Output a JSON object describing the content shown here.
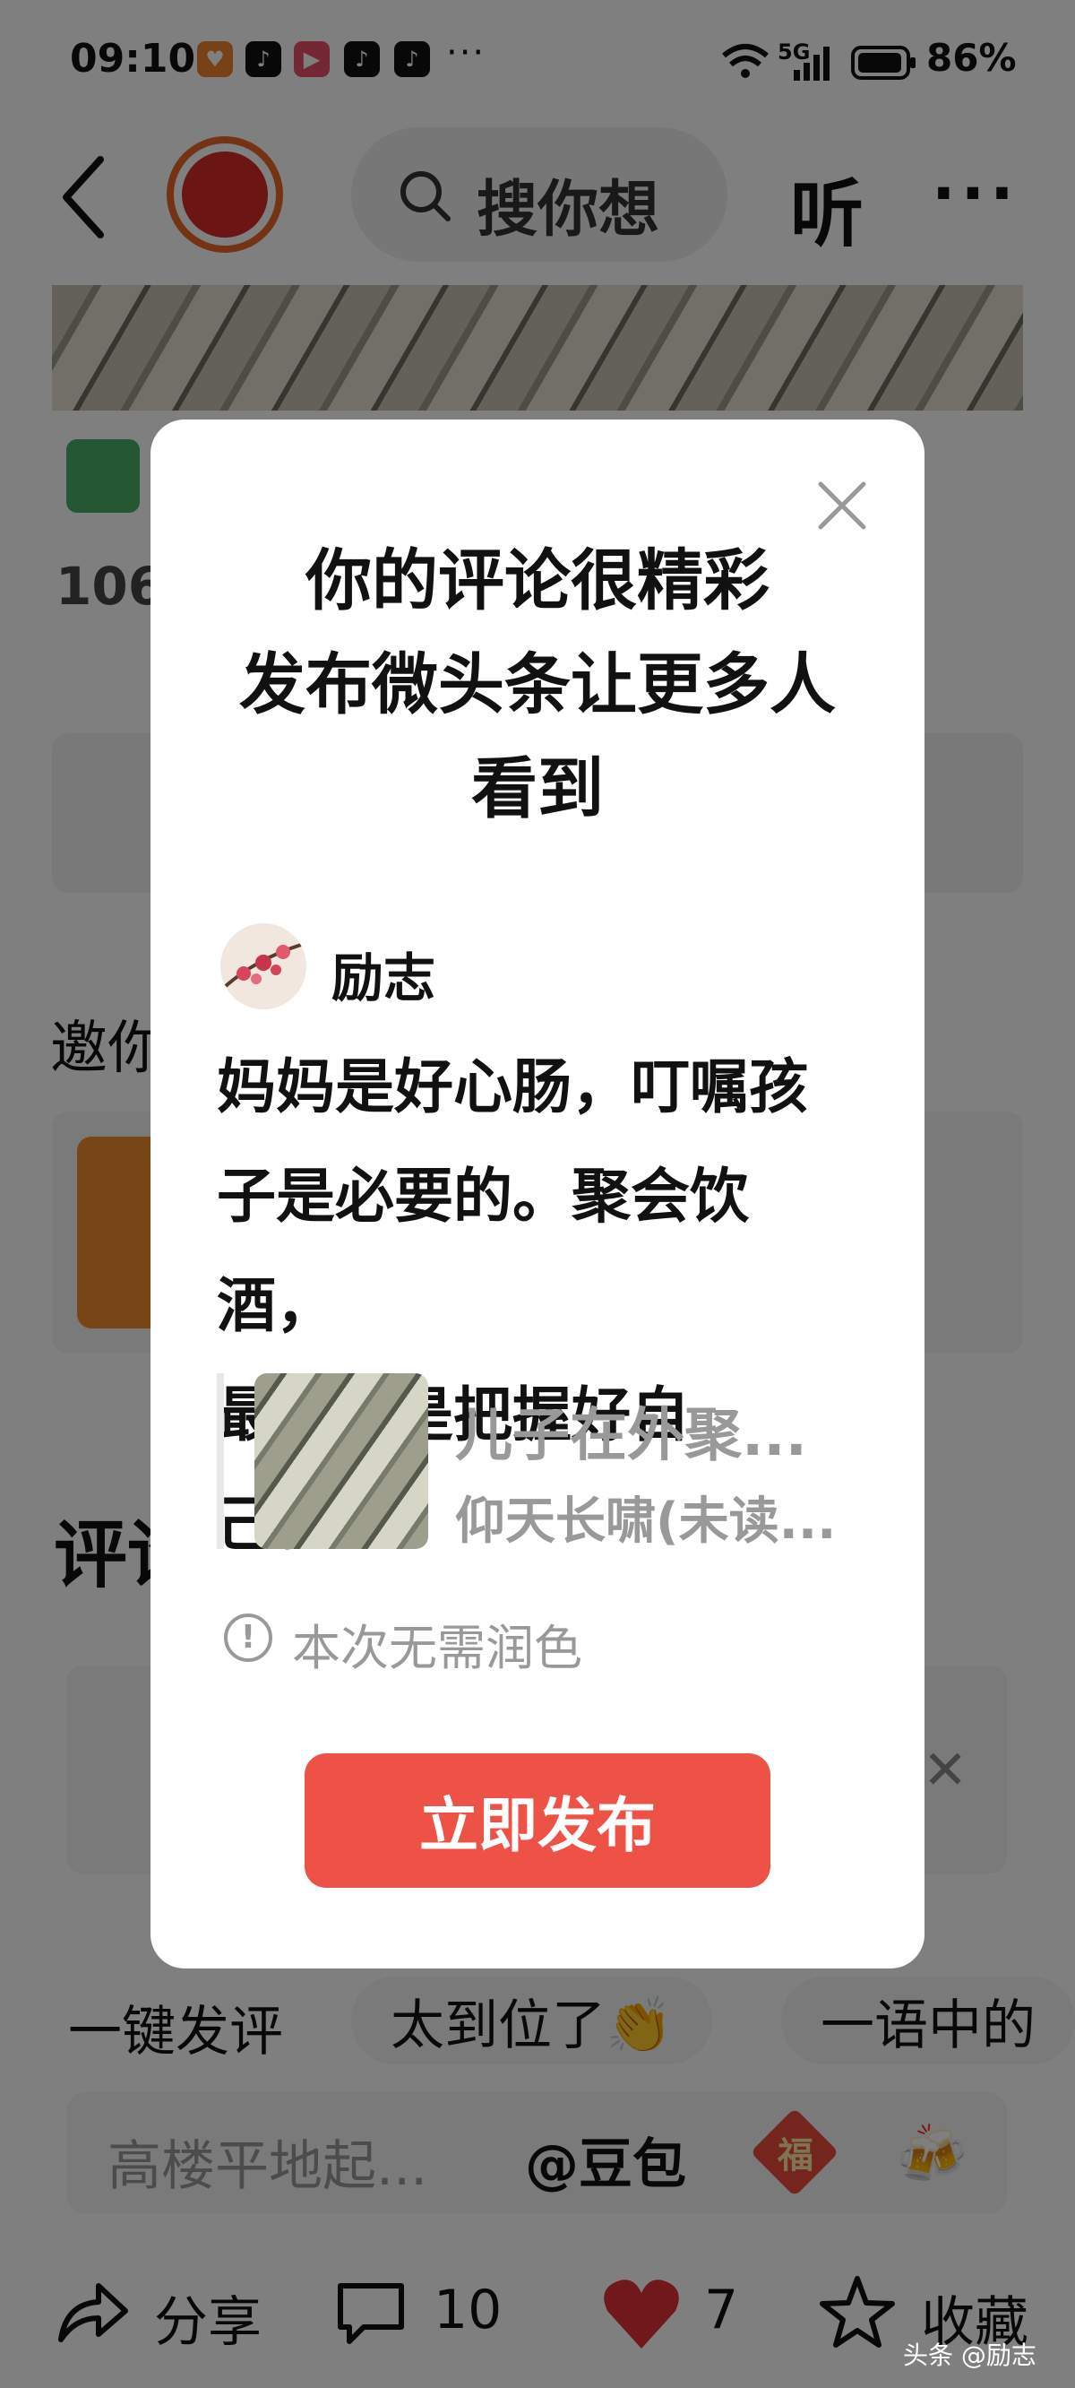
{
  "status_bar": {
    "time": "09:10",
    "network": "5G",
    "battery": "86%",
    "more": "···"
  },
  "header": {
    "search_placeholder": "搜你想",
    "listen_label": "听",
    "more_label": "···"
  },
  "background": {
    "views_prefix": "106",
    "invite_prefix": "邀你",
    "comments_heading_prefix": "评论",
    "quick_chip_label": "一键发评",
    "chips": [
      "太到位了👏",
      "一语中的"
    ],
    "comment_input_placeholder": "高楼平地起...",
    "mention_label": "@豆包",
    "fu_char": "福",
    "share_label": "分享",
    "comment_count": "10",
    "like_count": "7",
    "favorite_label": "收藏",
    "watermark": "头条 @励志"
  },
  "modal": {
    "title_lines": [
      "你的评论很精彩",
      "发布微头条让更多人",
      "看到"
    ],
    "author_name": "励志",
    "comment_lines": [
      "妈妈是好心肠，叮嘱孩",
      "子是必要的。聚会饮酒，",
      "最难的是把握好自己。..."
    ],
    "ref_title": "儿子在外聚...",
    "ref_author": "仰天长啸(未读...",
    "notice_icon": "!",
    "notice_text": "本次无需润色",
    "publish_label": "立即发布"
  },
  "colors": {
    "accent_red": "#ee5247",
    "like_red": "#e2313a",
    "overlay": "rgba(0,0,0,0.5)"
  }
}
